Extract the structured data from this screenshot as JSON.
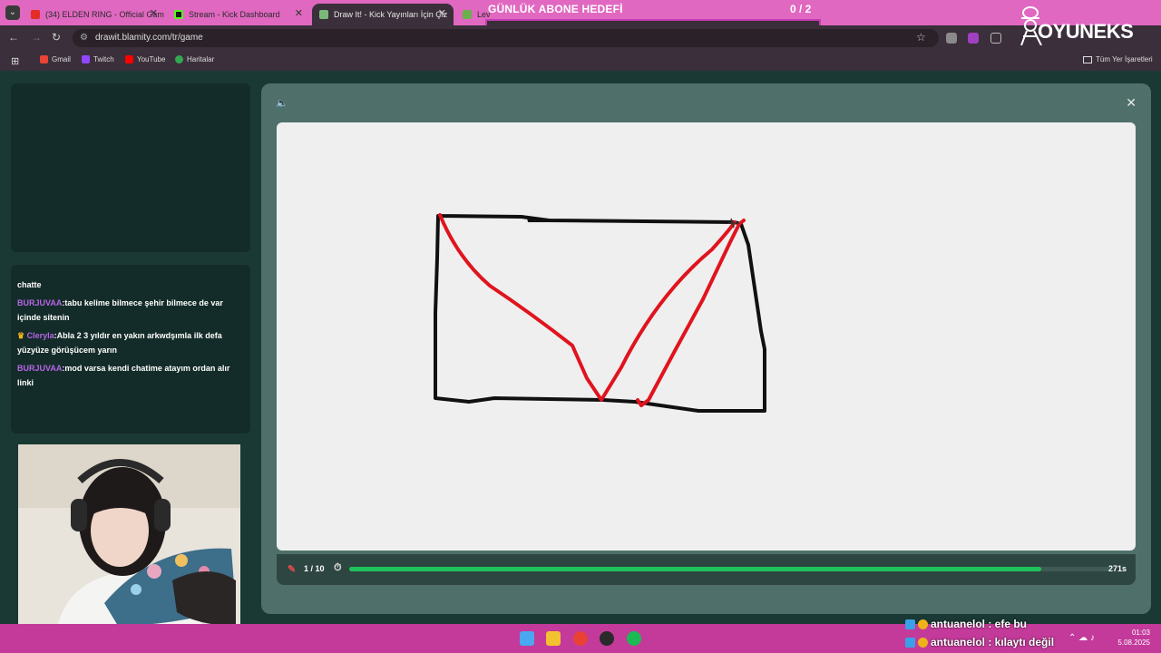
{
  "tabs": [
    {
      "label": "(34) ELDEN RING - Official Gam",
      "active": false
    },
    {
      "label": "Stream - Kick Dashboard",
      "active": false
    },
    {
      "label": "Draw It! - Kick Yayınları İçin Çiz",
      "active": true
    },
    {
      "label": "Lev",
      "active": false
    }
  ],
  "goal": {
    "title": "GÜNLÜK ABONE HEDEFİ",
    "count": "0  / 2"
  },
  "address": {
    "url": "drawit.blamity.com/tr/game"
  },
  "bookmarks": [
    "Gmail",
    "Twitch",
    "YouTube",
    "Haritalar"
  ],
  "bookmarks_all": "Tüm Yer İşaretleri",
  "logo": {
    "text": "OYUNEKS"
  },
  "chat": {
    "partial": "chatte",
    "messages": [
      {
        "user": "BURJUVAA",
        "text": ":tabu kelime bilmece şehir bilmece de var içinde sitenin"
      },
      {
        "user": "Cleryla",
        "text": ":Abla 2 3 yıldır en yakın arkwdşımla ilk defa yüzyüze görüşücem yarın"
      },
      {
        "user": "BURJUVAA",
        "text": ":mod varsa kendi chatime atayım ordan alır linki"
      }
    ]
  },
  "game": {
    "round": "1 / 10",
    "time": "271s",
    "progress": 0.91,
    "colors": {
      "accent": "#20c25b",
      "stroke_black": "#111111",
      "stroke_red": "#e0141e"
    }
  },
  "overlay_chat": [
    {
      "text": "antuanelol : efe bu"
    },
    {
      "text": "antuanelol : kılaytı değil"
    }
  ],
  "clock": {
    "time": "01:03",
    "date": "5.08.2025"
  }
}
